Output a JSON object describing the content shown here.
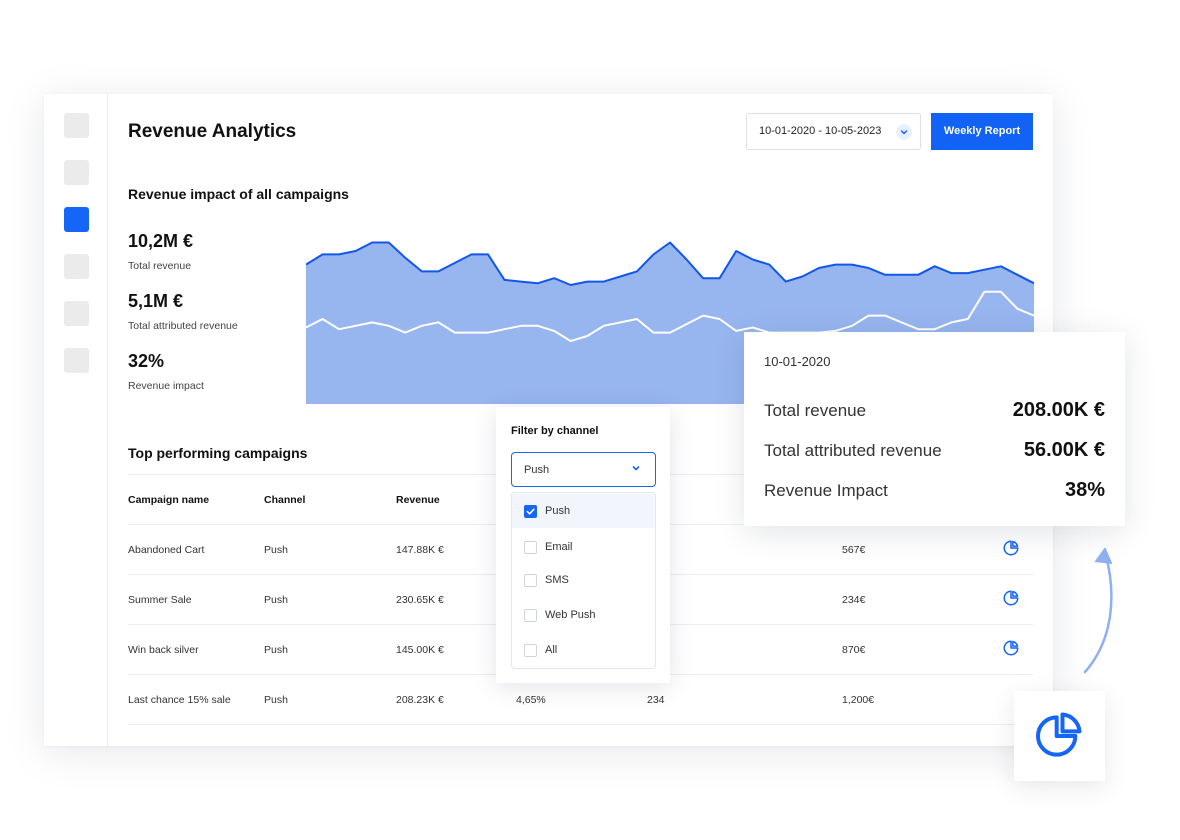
{
  "header": {
    "title": "Revenue Analytics",
    "date_range": "10-01-2020 - 10-05-2023",
    "weekly_report_label": "Weekly Report"
  },
  "impact_section": {
    "title": "Revenue impact of all campaigns",
    "stats": [
      {
        "value": "10,2M €",
        "label": "Total revenue"
      },
      {
        "value": "5,1M €",
        "label": "Total attributed revenue"
      },
      {
        "value": "32%",
        "label": "Revenue impact"
      }
    ]
  },
  "chart_data": {
    "type": "area",
    "x": [
      1,
      2,
      3,
      4,
      5,
      6,
      7,
      8,
      9,
      10,
      11,
      12,
      13,
      14,
      15,
      16,
      17,
      18,
      19,
      20,
      21,
      22,
      23,
      24,
      25,
      26,
      27,
      28,
      29,
      30,
      31,
      32,
      33,
      34,
      35,
      36,
      37,
      38,
      39,
      40,
      41,
      42,
      43,
      44,
      45
    ],
    "series": [
      {
        "values": [
          82,
          88,
          88,
          90,
          95,
          95,
          86,
          78,
          78,
          83,
          88,
          88,
          73,
          72,
          71,
          74,
          70,
          72,
          72,
          75,
          78,
          88,
          95,
          85,
          74,
          74,
          90,
          85,
          82,
          72,
          75,
          80,
          82,
          82,
          80,
          76,
          76,
          76,
          81,
          77,
          77,
          79,
          81,
          76,
          71
        ]
      },
      {
        "values": [
          45,
          50,
          44,
          46,
          48,
          46,
          42,
          46,
          48,
          42,
          42,
          42,
          44,
          46,
          46,
          43,
          37,
          40,
          46,
          48,
          50,
          42,
          42,
          47,
          52,
          50,
          43,
          45,
          42,
          42,
          42,
          42,
          43,
          46,
          52,
          52,
          48,
          44,
          44,
          48,
          50,
          66,
          66,
          56,
          52
        ]
      }
    ],
    "colors": {
      "area": "#97b5ef",
      "outline": "#1257e8",
      "secondary_line": "#ffffff"
    }
  },
  "campaigns": {
    "title": "Top performing campaigns",
    "columns": [
      "Campaign name",
      "Channel",
      "Revenue"
    ],
    "rows": [
      {
        "name": "Abandoned Cart",
        "channel": "Push",
        "revenue": "147.88K €",
        "extra": "567€"
      },
      {
        "name": "Summer Sale",
        "channel": "Push",
        "revenue": "230.65K €",
        "extra": "234€"
      },
      {
        "name": "Win back silver",
        "channel": "Push",
        "revenue": "145.00K €",
        "extra": "870€"
      },
      {
        "name": "Last chance 15% sale",
        "channel": "Push",
        "revenue": "208.23K €",
        "pct": "4,65%",
        "count": "234",
        "extra": "1,200€"
      }
    ]
  },
  "filter": {
    "title": "Filter by channel",
    "selected": "Push",
    "options": [
      {
        "label": "Push",
        "checked": true
      },
      {
        "label": "Email",
        "checked": false
      },
      {
        "label": "SMS",
        "checked": false
      },
      {
        "label": "Web Push",
        "checked": false
      },
      {
        "label": "All",
        "checked": false
      }
    ]
  },
  "tooltip": {
    "date": "10-01-2020",
    "rows": [
      {
        "label": "Total revenue",
        "value": "208.00K €"
      },
      {
        "label": "Total attributed revenue",
        "value": "56.00K €"
      },
      {
        "label": "Revenue Impact",
        "value": "38%"
      }
    ]
  },
  "icons": {
    "row_action": "pie-chart-icon",
    "fab": "pie-chart-icon",
    "arrow": "curved-arrow-icon",
    "chevron": "chevron-down-icon",
    "check": "check-icon"
  }
}
